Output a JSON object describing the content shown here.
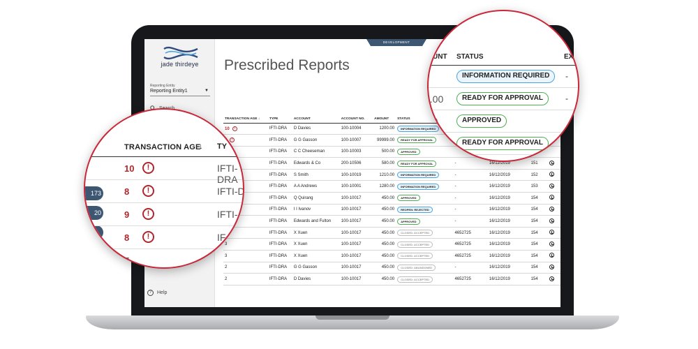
{
  "app": {
    "logo_text": "jade thirdeye",
    "environment": "DEVELOPMENT",
    "page_title": "Prescribed Reports"
  },
  "sidebar": {
    "entity_label": "Reporting Entity",
    "entity_value": "Reporting Entity1",
    "search_label": "Search",
    "help_label": "Help"
  },
  "table": {
    "headers": {
      "age": "TRANSACTION AGE",
      "type": "TYPE",
      "account": "ACCOUNT",
      "account_no": "ACCOUNT NO.",
      "amount": "AMOUNT",
      "status": "STATUS"
    },
    "rows": [
      {
        "age": "10",
        "alert": true,
        "type": "IFTI-DRA",
        "account": "D Davies",
        "account_no": "100-10004",
        "amount": "1200.00",
        "status": "INFORMATION REQUIRED",
        "status_kind": "info",
        "ref": "",
        "date": "",
        "id": ""
      },
      {
        "age": "8",
        "alert": true,
        "type": "IFTI-DRA",
        "account": "G G Gasson",
        "account_no": "100-10007",
        "amount": "99999.00",
        "status": "READY FOR APPROVAL",
        "status_kind": "ready",
        "ref": "",
        "date": "",
        "id": ""
      },
      {
        "age": "9",
        "alert": true,
        "type": "IFTI-DRA",
        "account": "C C Cheeseman",
        "account_no": "100-10003",
        "amount": "500.00",
        "status": "APPROVED",
        "status_kind": "approved",
        "ref": "",
        "date": "",
        "id": ""
      },
      {
        "age": "8",
        "alert": true,
        "type": "IFTI-DRA",
        "account": "Edwards & Co",
        "account_no": "200-10506",
        "amount": "580.00",
        "status": "READY FOR APPROVAL",
        "status_kind": "ready",
        "ref": "-",
        "date": "16/12/2019",
        "id": "151"
      },
      {
        "age": "",
        "alert": false,
        "type": "IFTI-DRA",
        "account": "S Smith",
        "account_no": "100-10019",
        "amount": "1210.00",
        "status": "INFORMATION REQUIRED",
        "status_kind": "info",
        "ref": "-",
        "date": "16/12/2019",
        "id": "152"
      },
      {
        "age": "",
        "alert": false,
        "type": "IFTI-DRA",
        "account": "A A Andrews",
        "account_no": "100-10001",
        "amount": "1280.00",
        "status": "INFORMATION REQUIRED",
        "status_kind": "info",
        "ref": "-",
        "date": "16/12/2019",
        "id": "153"
      },
      {
        "age": "",
        "alert": false,
        "type": "IFTI-DRA",
        "account": "Q Quirang",
        "account_no": "100-10017",
        "amount": "450.00",
        "status": "APPROVED",
        "status_kind": "approved",
        "ref": "-",
        "date": "16/12/2019",
        "id": "154"
      },
      {
        "age": "",
        "alert": false,
        "type": "IFTI-DRA",
        "account": "I I Ivanov",
        "account_no": "100-10017",
        "amount": "450.00",
        "status": "REOPEN: REJECTED",
        "status_kind": "rejected",
        "ref": "-",
        "date": "16/12/2019",
        "id": "154"
      },
      {
        "age": "",
        "alert": false,
        "type": "IFTI-DRA",
        "account": "Edwards and Fulton",
        "account_no": "100-10017",
        "amount": "450.00",
        "status": "APPROVED",
        "status_kind": "approved",
        "ref": "-",
        "date": "16/12/2019",
        "id": "154"
      },
      {
        "age": "",
        "alert": false,
        "type": "IFTI-DRA",
        "account": "X Xuen",
        "account_no": "100-10017",
        "amount": "450.00",
        "status": "CLOSED: ACCEPTED",
        "status_kind": "closed",
        "ref": "4652725",
        "date": "16/12/2019",
        "id": "154"
      },
      {
        "age": "3",
        "alert": false,
        "type": "IFTI-DRA",
        "account": "X Xuen",
        "account_no": "100-10017",
        "amount": "450.00",
        "status": "CLOSED: ACCEPTED",
        "status_kind": "closed",
        "ref": "4652725",
        "date": "16/12/2019",
        "id": "154"
      },
      {
        "age": "3",
        "alert": false,
        "type": "IFTI-DRA",
        "account": "X Xuen",
        "account_no": "100-10017",
        "amount": "450.00",
        "status": "CLOSED: ACCEPTED",
        "status_kind": "closed",
        "ref": "4652725",
        "date": "16/12/2019",
        "id": "154"
      },
      {
        "age": "2",
        "alert": false,
        "type": "IFTI-DRA",
        "account": "G G Gasson",
        "account_no": "100-10017",
        "amount": "450.00",
        "status": "CLOSED: ABANDONED",
        "status_kind": "closed",
        "ref": "-",
        "date": "16/12/2019",
        "id": "154"
      },
      {
        "age": "2",
        "alert": false,
        "type": "IFTI-DRA",
        "account": "D Davies",
        "account_no": "100-10017",
        "amount": "450.00",
        "status": "CLOSED: ACCEPTED",
        "status_kind": "closed",
        "ref": "4652725",
        "date": "16/12/2019",
        "id": "154"
      }
    ]
  },
  "zoom_left": {
    "header": "TRANSACTION AGE",
    "sort_arrow": "↓",
    "type_header": "TY",
    "badges": [
      "173",
      "20",
      ""
    ],
    "rows": [
      {
        "age": "10",
        "type": "IFTI-DRA"
      },
      {
        "age": "8",
        "type": "IFTI-D"
      },
      {
        "age": "9",
        "type": "IFTI-"
      },
      {
        "age": "8",
        "type": "IF"
      },
      {
        "age": "7",
        "type": ""
      }
    ]
  },
  "zoom_right": {
    "headers": {
      "amount": "UNT",
      "status": "STATUS",
      "extra": "EX"
    },
    "rows": [
      {
        "amount": "",
        "status": "INFORMATION REQUIRED",
        "status_kind": "info",
        "extra": "-"
      },
      {
        "amount": "9.00",
        "status": "READY FOR APPROVAL",
        "status_kind": "ready",
        "extra": "-"
      },
      {
        "amount": ".00",
        "status": "APPROVED",
        "status_kind": "approved",
        "extra": ""
      },
      {
        "amount": "",
        "status": "READY FOR APPROVAL",
        "status_kind": "ready",
        "extra": ""
      }
    ]
  },
  "colors": {
    "alert_red": "#b1262d",
    "brand_navy": "#3d5672",
    "info_blue": "#4aa3df",
    "ready_green": "#4caf50",
    "ring_red": "#c9283b"
  }
}
